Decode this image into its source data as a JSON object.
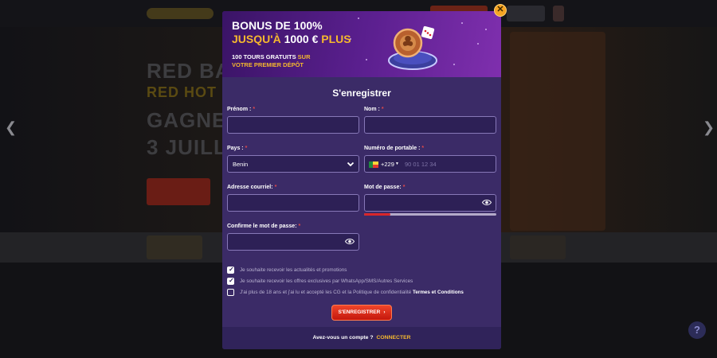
{
  "banner": {
    "line1": "BONUS DE 100%",
    "line2_gold": "JUSQU'À",
    "line2_amount": "1000 €",
    "line2_plus": "PLUS",
    "sub1_white": "100 TOURS GRATUITS",
    "sub1_gold": "SUR",
    "sub2": "VOTRE PREMIER DÉPÔT"
  },
  "form": {
    "title": "S'enregistrer",
    "first_name_label": "Prénom :",
    "last_name_label": "Nom :",
    "country_label": "Pays :",
    "country_value": "Benin",
    "phone_label": "Numéro de portable :",
    "phone_dial_code": "+229",
    "phone_placeholder": "90 01 12 34",
    "email_label": "Adresse courriel:",
    "password_label": "Mot de passe:",
    "confirm_label": "Confirme le mot de passe:",
    "required_mark": "*",
    "password_strength": 0.2
  },
  "checkboxes": [
    {
      "text": "Je souhaite recevoir les actualités et promotions",
      "checked": true
    },
    {
      "text": "Je souhaite recevoir les offres exclusives par WhatsApp/SMS/Autres Services",
      "checked": true
    },
    {
      "text": "J'ai plus de 18 ans et j'ai lu et accepté les CG et la Politique de confidentialité",
      "link": "Termes et Conditions",
      "checked": false
    }
  ],
  "submit_label": "S'ENREGISTRER",
  "footer": {
    "question": "Avez-vous un compte ?",
    "link": "CONNECTER"
  },
  "icons": {
    "close": "close-icon",
    "chevron": "chevron-down-icon",
    "eye": "eye-icon",
    "arrow": "arrow-right-icon"
  },
  "colors": {
    "modal_bg": "#3b2b67",
    "accent_gold": "#f5b82e",
    "button_red": "#d9262a",
    "input_border": "#8778b8"
  }
}
